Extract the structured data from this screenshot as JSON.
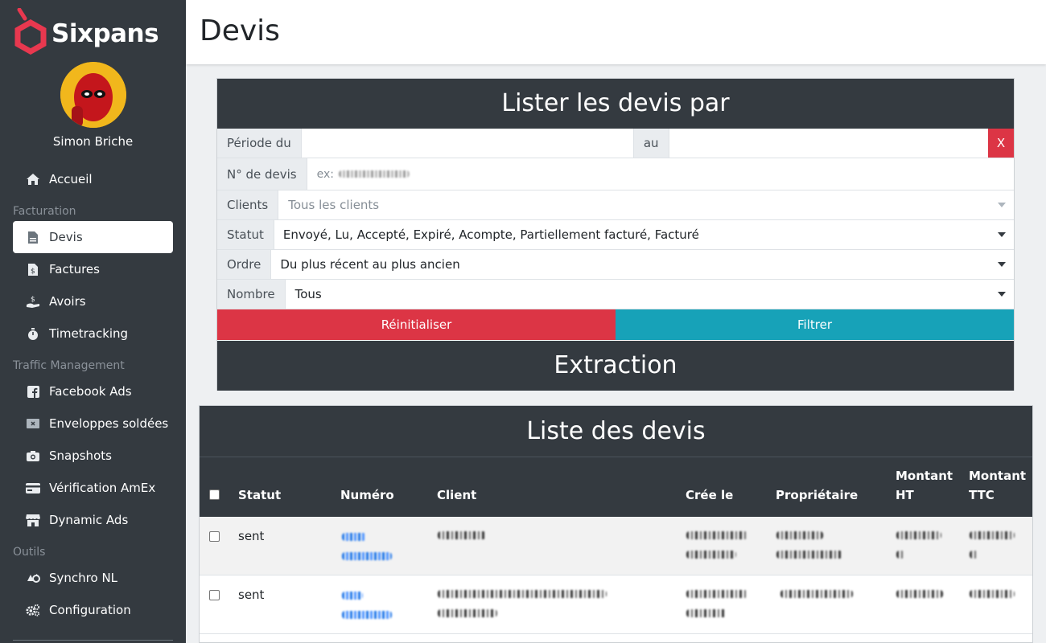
{
  "app": {
    "brand": "Sixpans",
    "brand_color": "#e8384f"
  },
  "user": {
    "name": "Simon Briche"
  },
  "sidebar": {
    "items": [
      {
        "label": "Accueil",
        "icon": "home-icon"
      },
      {
        "label": "Devis",
        "icon": "document-icon",
        "active": true
      },
      {
        "label": "Factures",
        "icon": "invoice-icon"
      },
      {
        "label": "Avoirs",
        "icon": "credit-hand-icon"
      },
      {
        "label": "Timetracking",
        "icon": "stopwatch-icon"
      },
      {
        "label": "Facebook Ads",
        "icon": "facebook-icon"
      },
      {
        "label": "Enveloppes soldées",
        "icon": "envelope-icon"
      },
      {
        "label": "Snapshots",
        "icon": "camera-icon"
      },
      {
        "label": "Vérification AmEx",
        "icon": "credit-card-icon"
      },
      {
        "label": "Dynamic Ads",
        "icon": "store-icon"
      },
      {
        "label": "Synchro NL",
        "icon": "sync-icon"
      },
      {
        "label": "Configuration",
        "icon": "gears-icon"
      }
    ],
    "sections": [
      "Facturation",
      "Traffic Management",
      "Outils"
    ]
  },
  "header": {
    "title": "Devis"
  },
  "filters": {
    "title": "Lister les devis par",
    "period_label": "Période du",
    "period_to_label": "au",
    "clear_label": "X",
    "number_label": "N° de devis",
    "number_placeholder": "ex:",
    "clients_label": "Clients",
    "clients_value": "Tous les clients",
    "status_label": "Statut",
    "status_value": "Envoyé, Lu, Accepté, Expiré, Acompte, Partiellement facturé, Facturé",
    "order_label": "Ordre",
    "order_value": "Du plus récent au plus ancien",
    "count_label": "Nombre",
    "count_value": "Tous",
    "reset_label": "Réinitialiser",
    "filter_label": "Filtrer",
    "extraction_label": "Extraction"
  },
  "table": {
    "title": "Liste des devis",
    "columns": [
      "Statut",
      "Numéro",
      "Client",
      "Crée le",
      "Propriétaire",
      "Montant HT",
      "Montant TTC"
    ],
    "rows": [
      {
        "status": "sent"
      },
      {
        "status": "sent"
      }
    ]
  }
}
